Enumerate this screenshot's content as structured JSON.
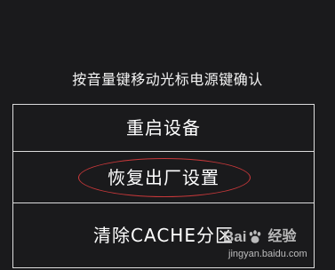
{
  "screen": {
    "hint": "按音量键移动光标电源键确认"
  },
  "menu": {
    "items": [
      {
        "label": "重启设备"
      },
      {
        "label": "恢复出厂设置",
        "circled": true
      },
      {
        "label": "清除CACHE分区"
      }
    ]
  },
  "watermark": {
    "brand_left": "Bai",
    "brand_right": "经验",
    "url": "jingyan.baidu.com"
  },
  "colors": {
    "background": "#1a1a1c",
    "text": "#ffffff",
    "border": "#dcdcdc",
    "highlight_circle": "#c8383a"
  }
}
